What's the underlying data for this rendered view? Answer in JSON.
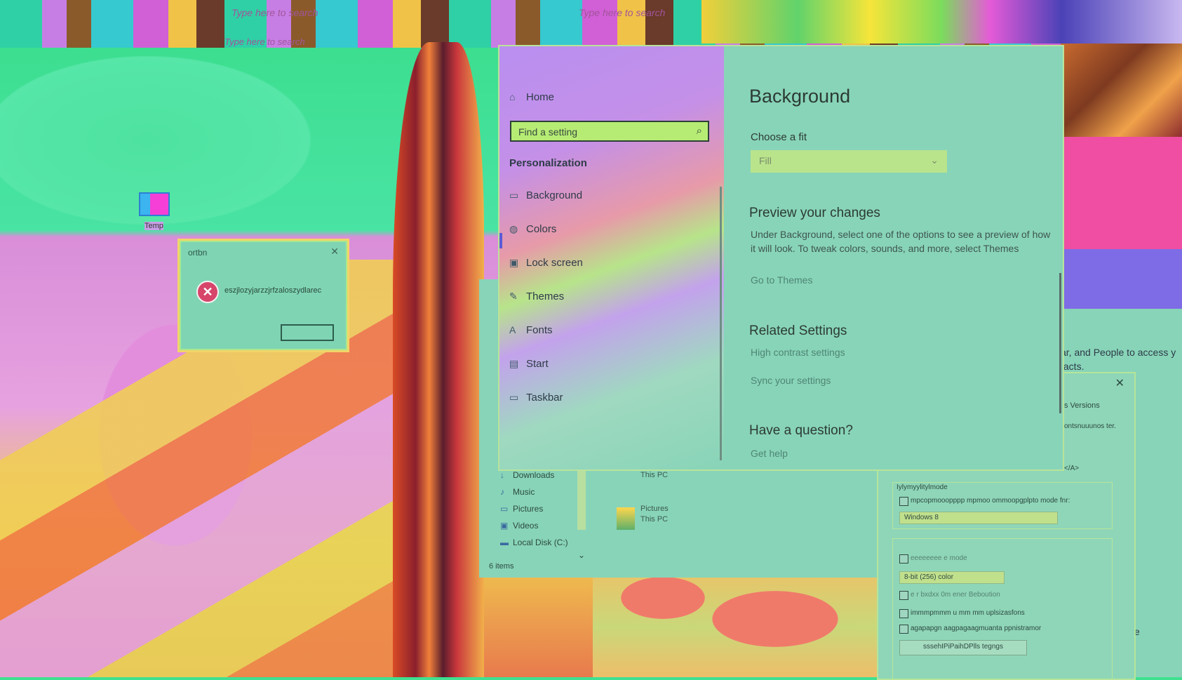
{
  "desktop": {
    "top_strip_texts": [
      "Type here to search",
      "Type here to search",
      "Type here to search"
    ],
    "icon_label": "Temp"
  },
  "error_dialog": {
    "title": "ortbn",
    "close_glyph": "✕",
    "error_glyph": "✕",
    "message": "eszjlozyjarzzjrfzaloszydlarec",
    "button_label": ""
  },
  "settings": {
    "sidebar": {
      "home_label": "Home",
      "search_placeholder": "Find a setting",
      "section_heading": "Personalization",
      "items": [
        {
          "label": "Background",
          "icon": "image-icon",
          "glyph": "▭"
        },
        {
          "label": "Colors",
          "icon": "palette-icon",
          "glyph": "◍"
        },
        {
          "label": "Lock screen",
          "icon": "lock-screen-icon",
          "glyph": "▣"
        },
        {
          "label": "Themes",
          "icon": "themes-icon",
          "glyph": "✎"
        },
        {
          "label": "Fonts",
          "icon": "fonts-icon",
          "glyph": "A"
        },
        {
          "label": "Start",
          "icon": "start-icon",
          "glyph": "▤"
        },
        {
          "label": "Taskbar",
          "icon": "taskbar-icon",
          "glyph": "▭"
        }
      ]
    },
    "main": {
      "title": "Background",
      "fit_label": "Choose a fit",
      "fit_value": "Fill",
      "preview_heading": "Preview your changes",
      "preview_body": "Under Background, select one of the options to see a preview of how it will look. To tweak colors, sounds, and more, select Themes",
      "themes_link": "Go to Themes",
      "related_heading": "Related Settings",
      "high_contrast_link": "High contrast settings",
      "sync_link": "Sync your settings",
      "question_heading": "Have a question?",
      "help_link": "Get help"
    }
  },
  "explorer": {
    "nav_items": [
      "Downloads",
      "Music",
      "Pictures",
      "Videos",
      "Local Disk (C:)"
    ],
    "status": "6 items",
    "tiles": [
      {
        "name": "This PC",
        "sub": ""
      },
      {
        "name": "Pictures",
        "sub": "This PC"
      }
    ]
  },
  "compat_props": {
    "tab_label": "s Versions",
    "desc_text": "ontsnuuunos ter.",
    "link_text": "</A>",
    "group1_label": "Iylymyylitylmode",
    "check1_label": "mpcopmooopppp mpmoo ommoopgplpto mode fnr:",
    "os_value": "Windows 8",
    "group2_check_label": "eeeeeeee e mode",
    "color_value": "8-bit (256) color",
    "check2_label": "e r bxdxx 0m ener Beboution",
    "check3_label": "immmpmmm u mm mm uplsizasfons",
    "check4_label": "agapapgn aagpagaagmuanta ppnistramor",
    "button_label": "sssehIPiPaihDPlls tegngs"
  },
  "people_panel": {
    "text": "ar, and People to access y tacts.",
    "close_fragment": "se"
  }
}
